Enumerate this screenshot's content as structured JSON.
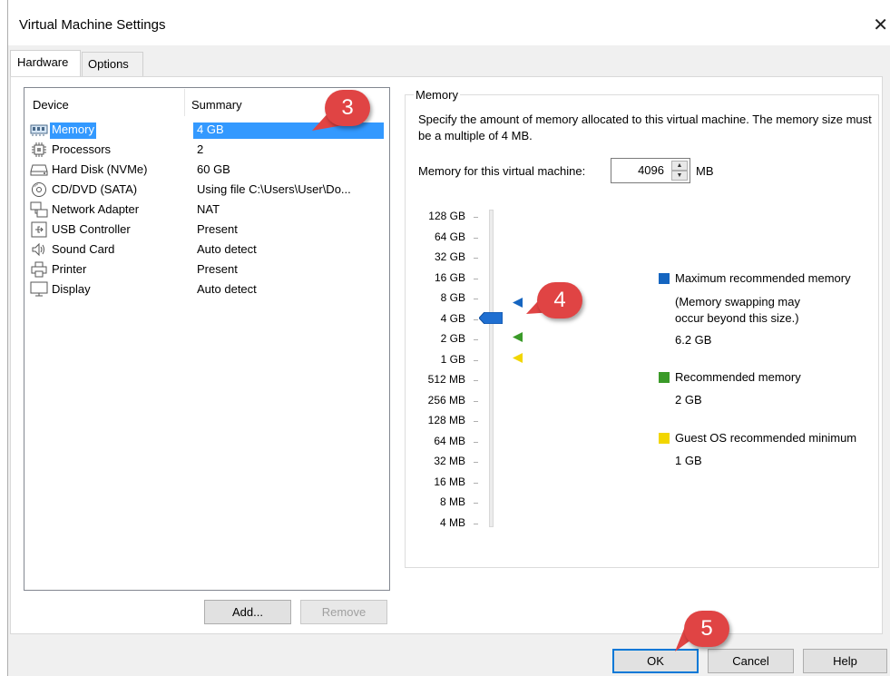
{
  "window": {
    "title": "Virtual Machine Settings",
    "close_glyph": "✕"
  },
  "tabs": [
    {
      "label": "Hardware",
      "active": true
    },
    {
      "label": "Options",
      "active": false
    }
  ],
  "device_list": {
    "columns": [
      "Device",
      "Summary"
    ],
    "rows": [
      {
        "icon": "memory-icon",
        "name": "Memory",
        "summary": "4 GB",
        "selected": true
      },
      {
        "icon": "processor-icon",
        "name": "Processors",
        "summary": "2"
      },
      {
        "icon": "hard-disk-icon",
        "name": "Hard Disk (NVMe)",
        "summary": "60 GB"
      },
      {
        "icon": "cd-dvd-icon",
        "name": "CD/DVD (SATA)",
        "summary": "Using file C:\\Users\\User\\Do..."
      },
      {
        "icon": "network-icon",
        "name": "Network Adapter",
        "summary": "NAT"
      },
      {
        "icon": "usb-icon",
        "name": "USB Controller",
        "summary": "Present"
      },
      {
        "icon": "sound-icon",
        "name": "Sound Card",
        "summary": "Auto detect"
      },
      {
        "icon": "printer-icon",
        "name": "Printer",
        "summary": "Present"
      },
      {
        "icon": "display-icon",
        "name": "Display",
        "summary": "Auto detect"
      }
    ],
    "add_label": "Add...",
    "remove_label": "Remove"
  },
  "memory": {
    "group_title": "Memory",
    "description": "Specify the amount of memory allocated to this virtual machine. The memory size must be a multiple of 4 MB.",
    "field_label": "Memory for this virtual machine:",
    "value": "4096",
    "unit": "MB",
    "scale_labels": [
      "128 GB",
      "64 GB",
      "32 GB",
      "16 GB",
      "8 GB",
      "4 GB",
      "2 GB",
      "1 GB",
      "512 MB",
      "256 MB",
      "128 MB",
      "64 MB",
      "32 MB",
      "16 MB",
      "8 MB",
      "4 MB"
    ],
    "current_level": "4 GB",
    "legend": {
      "maximum": {
        "title": "Maximum recommended memory",
        "note_line1": "(Memory swapping may",
        "note_line2": "occur beyond this size.)",
        "value": "6.2 GB",
        "color": "#1565c0"
      },
      "recommended": {
        "title": "Recommended memory",
        "value": "2 GB",
        "color": "#3a9a28"
      },
      "guest_min": {
        "title": "Guest OS recommended minimum",
        "value": "1 GB",
        "color": "#f2d600"
      }
    }
  },
  "footer": {
    "ok_label": "OK",
    "cancel_label": "Cancel",
    "help_label": "Help"
  },
  "callouts": [
    "3",
    "4",
    "5"
  ],
  "colors": {
    "selection": "#3399ff",
    "callout": "#e04444",
    "default_button_border": "#0078d7"
  }
}
